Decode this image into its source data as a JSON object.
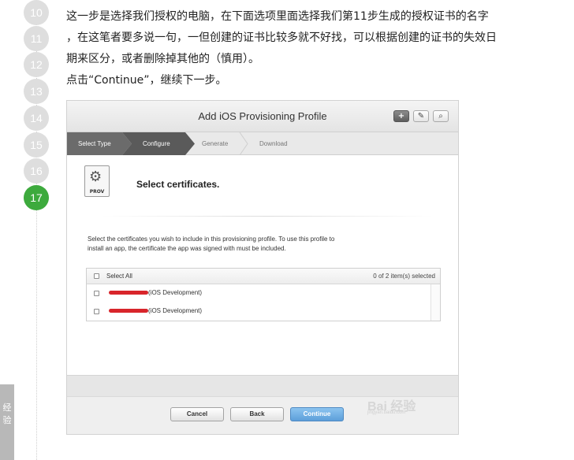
{
  "steps": [
    {
      "num": "10",
      "active": false
    },
    {
      "num": "11",
      "active": false
    },
    {
      "num": "12",
      "active": false
    },
    {
      "num": "13",
      "active": false
    },
    {
      "num": "14",
      "active": false
    },
    {
      "num": "15",
      "active": false
    },
    {
      "num": "16",
      "active": false
    },
    {
      "num": "17",
      "active": true
    }
  ],
  "side_tab": "经验",
  "instructions": {
    "line1": "这一步是选择我们授权的电脑，在下面选项里面选择我们第11步生成的授权证书的名字",
    "line2": "，在这笔者要多说一句，一但创建的证书比较多就不好找，可以根据创建的证书的失效日",
    "line3": "期来区分，或者删除掉其他的（慎用）。",
    "line4": "点击“Continue”，继续下一步。"
  },
  "window": {
    "title": "Add iOS Provisioning Profile",
    "toolbar_icons": [
      "plus-icon",
      "edit-icon",
      "search-icon"
    ]
  },
  "wizard_steps": [
    "Select Type",
    "Configure",
    "Generate",
    "Download"
  ],
  "file_icon": {
    "label": "PROV"
  },
  "heading": "Select certificates.",
  "description": {
    "line1": "Select the certificates you wish to include in this provisioning profile. To use this profile to",
    "line2": "install an app, the certificate the app was signed with must be included."
  },
  "cert_list": {
    "select_all": "Select All",
    "count": "0 of 2 item(s) selected",
    "rows": [
      {
        "label": "(iOS Development)",
        "checked": false
      },
      {
        "label": "(iOS Development)",
        "checked": false
      }
    ]
  },
  "buttons": {
    "cancel": "Cancel",
    "back": "Back",
    "continue": "Continue"
  },
  "watermark": {
    "main": "Bai  经验",
    "sub": "jingyan.baidu.com"
  },
  "colors": {
    "active_step": "#3daa3d",
    "continue_button": "#5d9fda",
    "redaction": "#d8252b"
  }
}
